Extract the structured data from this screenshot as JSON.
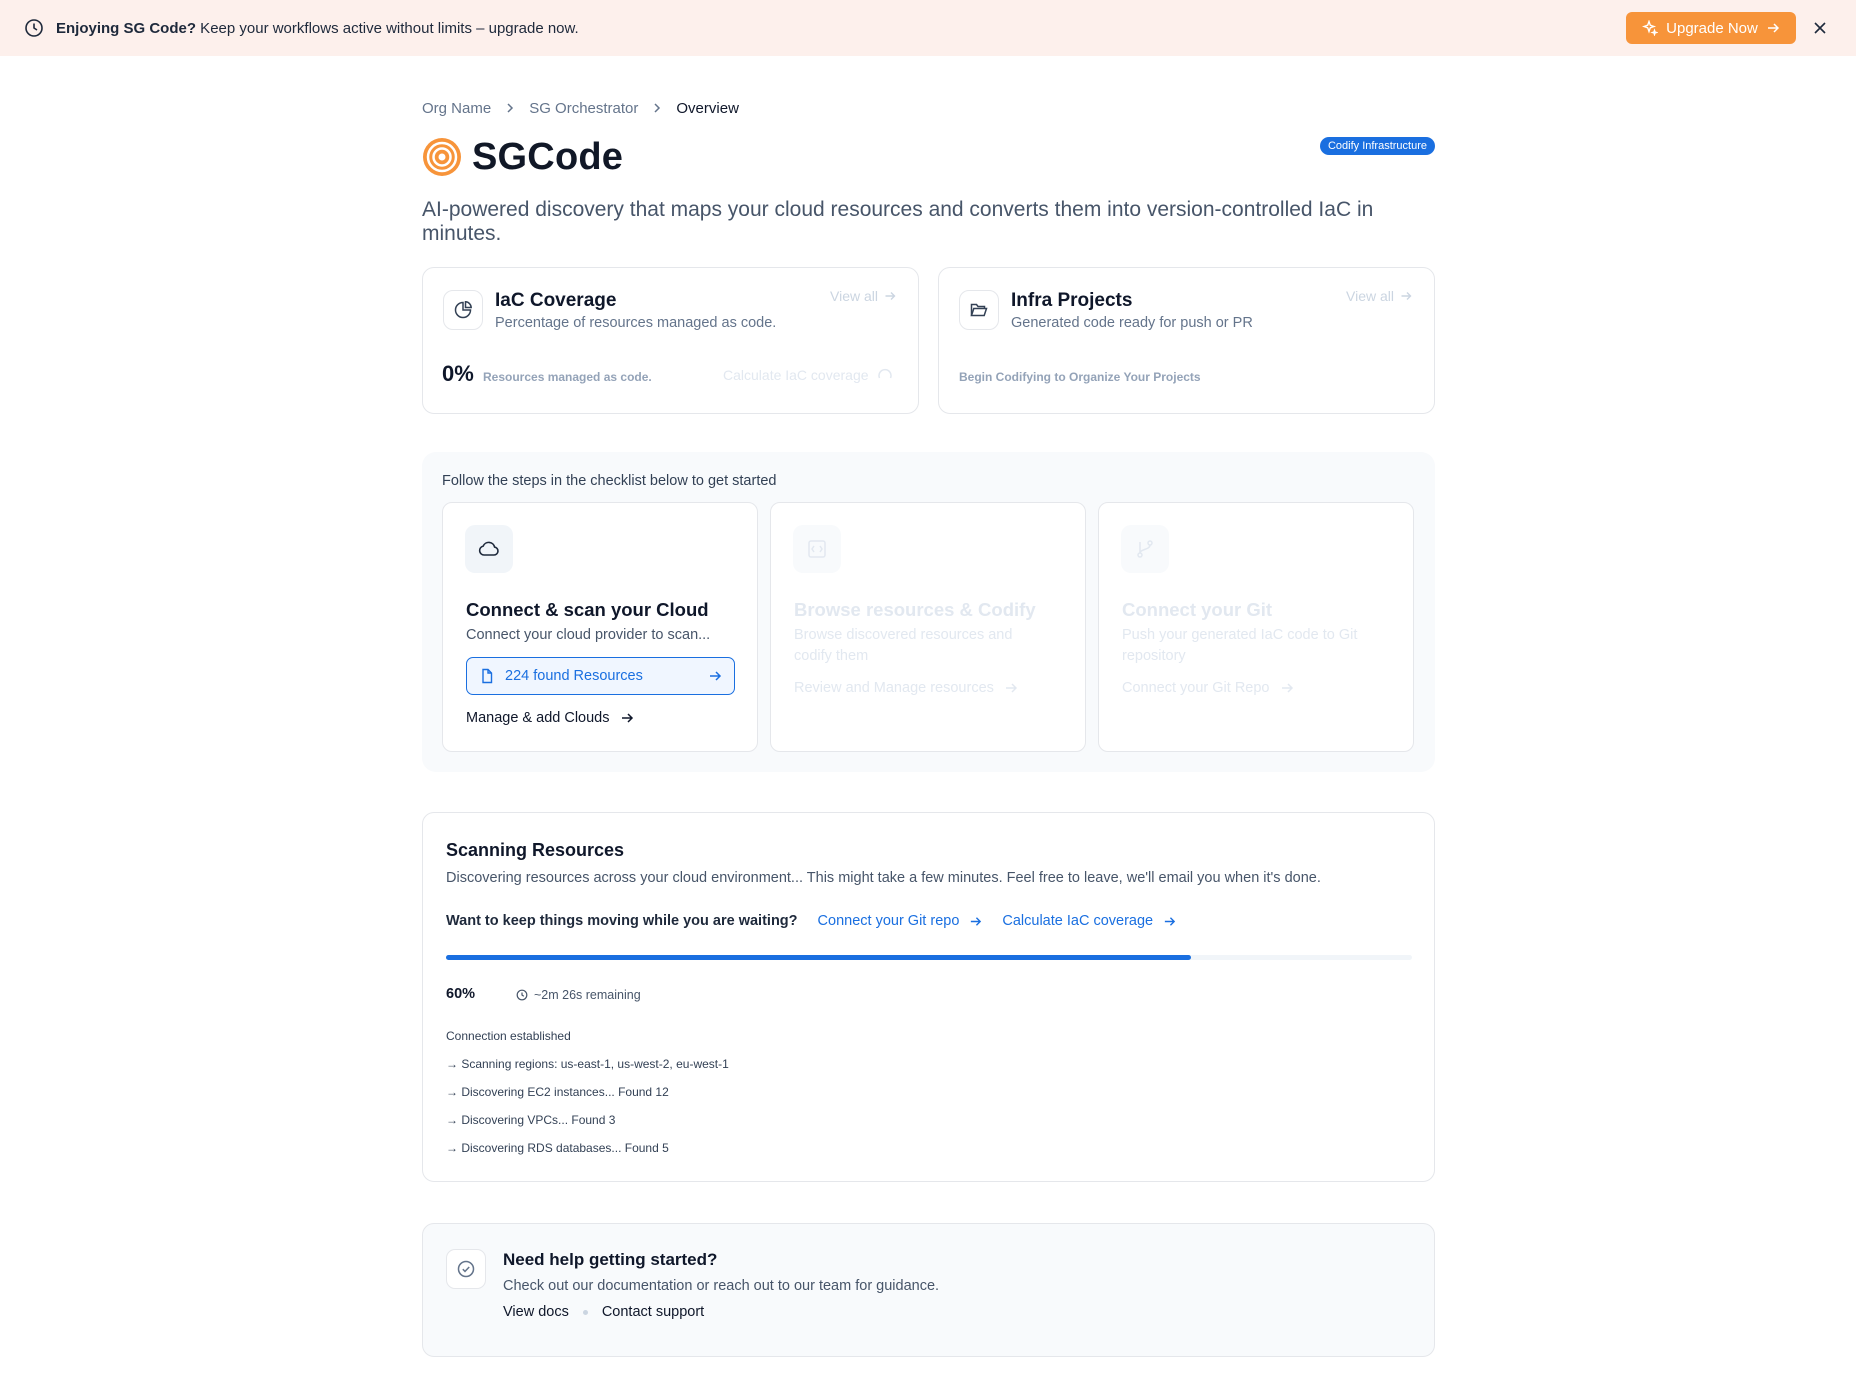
{
  "banner": {
    "bold": "Enjoying SG Code?",
    "text": " Keep your workflows active without limits – upgrade now.",
    "upgrade_label": "Upgrade Now"
  },
  "breadcrumb": [
    "Org Name",
    "SG Orchestrator",
    "Overview"
  ],
  "header": {
    "title": "SGCode",
    "badge": "Codify Infrastructure",
    "subtitle": "AI-powered discovery that maps your cloud resources and converts them into version-controlled IaC in minutes."
  },
  "coverage": {
    "title": "IaC Coverage",
    "desc": "Percentage of resources managed as code.",
    "view_all": "View all",
    "value": "0%",
    "value_caption": "Resources managed as code.",
    "calc_link": "Calculate IaC coverage"
  },
  "projects": {
    "title": "Infra Projects",
    "desc": "Generated code ready for push or PR",
    "view_all": "View all",
    "empty_caption": "Begin Codifying to Organize Your Projects"
  },
  "checklist": {
    "hint": "Follow the steps in the checklist below to get started",
    "steps": [
      {
        "title": "Connect & scan your Cloud",
        "desc": "Connect your cloud provider to scan...",
        "resource_btn": "224 found Resources",
        "link": "Manage & add Clouds"
      },
      {
        "title": "Browse resources & Codify",
        "desc": "Browse discovered resources and codify them",
        "link": "Review and Manage resources"
      },
      {
        "title": "Connect your Git",
        "desc": "Push your generated IaC code to Git repository",
        "link": "Connect your Git Repo"
      }
    ]
  },
  "scan": {
    "title": "Scanning Resources",
    "desc": "Discovering resources across your cloud environment... This might take a few minutes. Feel free to leave, we'll email you when it's done.",
    "cta_question": "Want to keep things moving while you are waiting?",
    "cta_git": "Connect your Git repo",
    "cta_coverage": "Calculate IaC coverage",
    "progress": 0.6,
    "percent_label": "60%",
    "remaining": "~2m 26s remaining",
    "log": [
      "Connection established",
      "→ Scanning regions: us-east-1, us-west-2, eu-west-1",
      "→ Discovering EC2 instances... Found 12",
      "→ Discovering VPCs... Found 3",
      "→ Discovering RDS databases... Found 5"
    ]
  },
  "help": {
    "title": "Need help getting started?",
    "desc": "Check out our documentation or reach out to our team for guidance.",
    "docs": "View docs",
    "support": "Contact support"
  },
  "colors": {
    "accent": "#1a6fe0",
    "brand_orange": "#f7943a",
    "banner_bg": "#fdf0ec"
  },
  "icons": [
    "clock-icon",
    "sparkle-icon",
    "close-icon",
    "chevron-right-icon",
    "pie-chart-icon",
    "folder-icon",
    "cloud-icon",
    "file-icon",
    "arrow-right-icon",
    "git-branch-icon",
    "code-icon",
    "check-circle-icon",
    "refresh-icon"
  ]
}
